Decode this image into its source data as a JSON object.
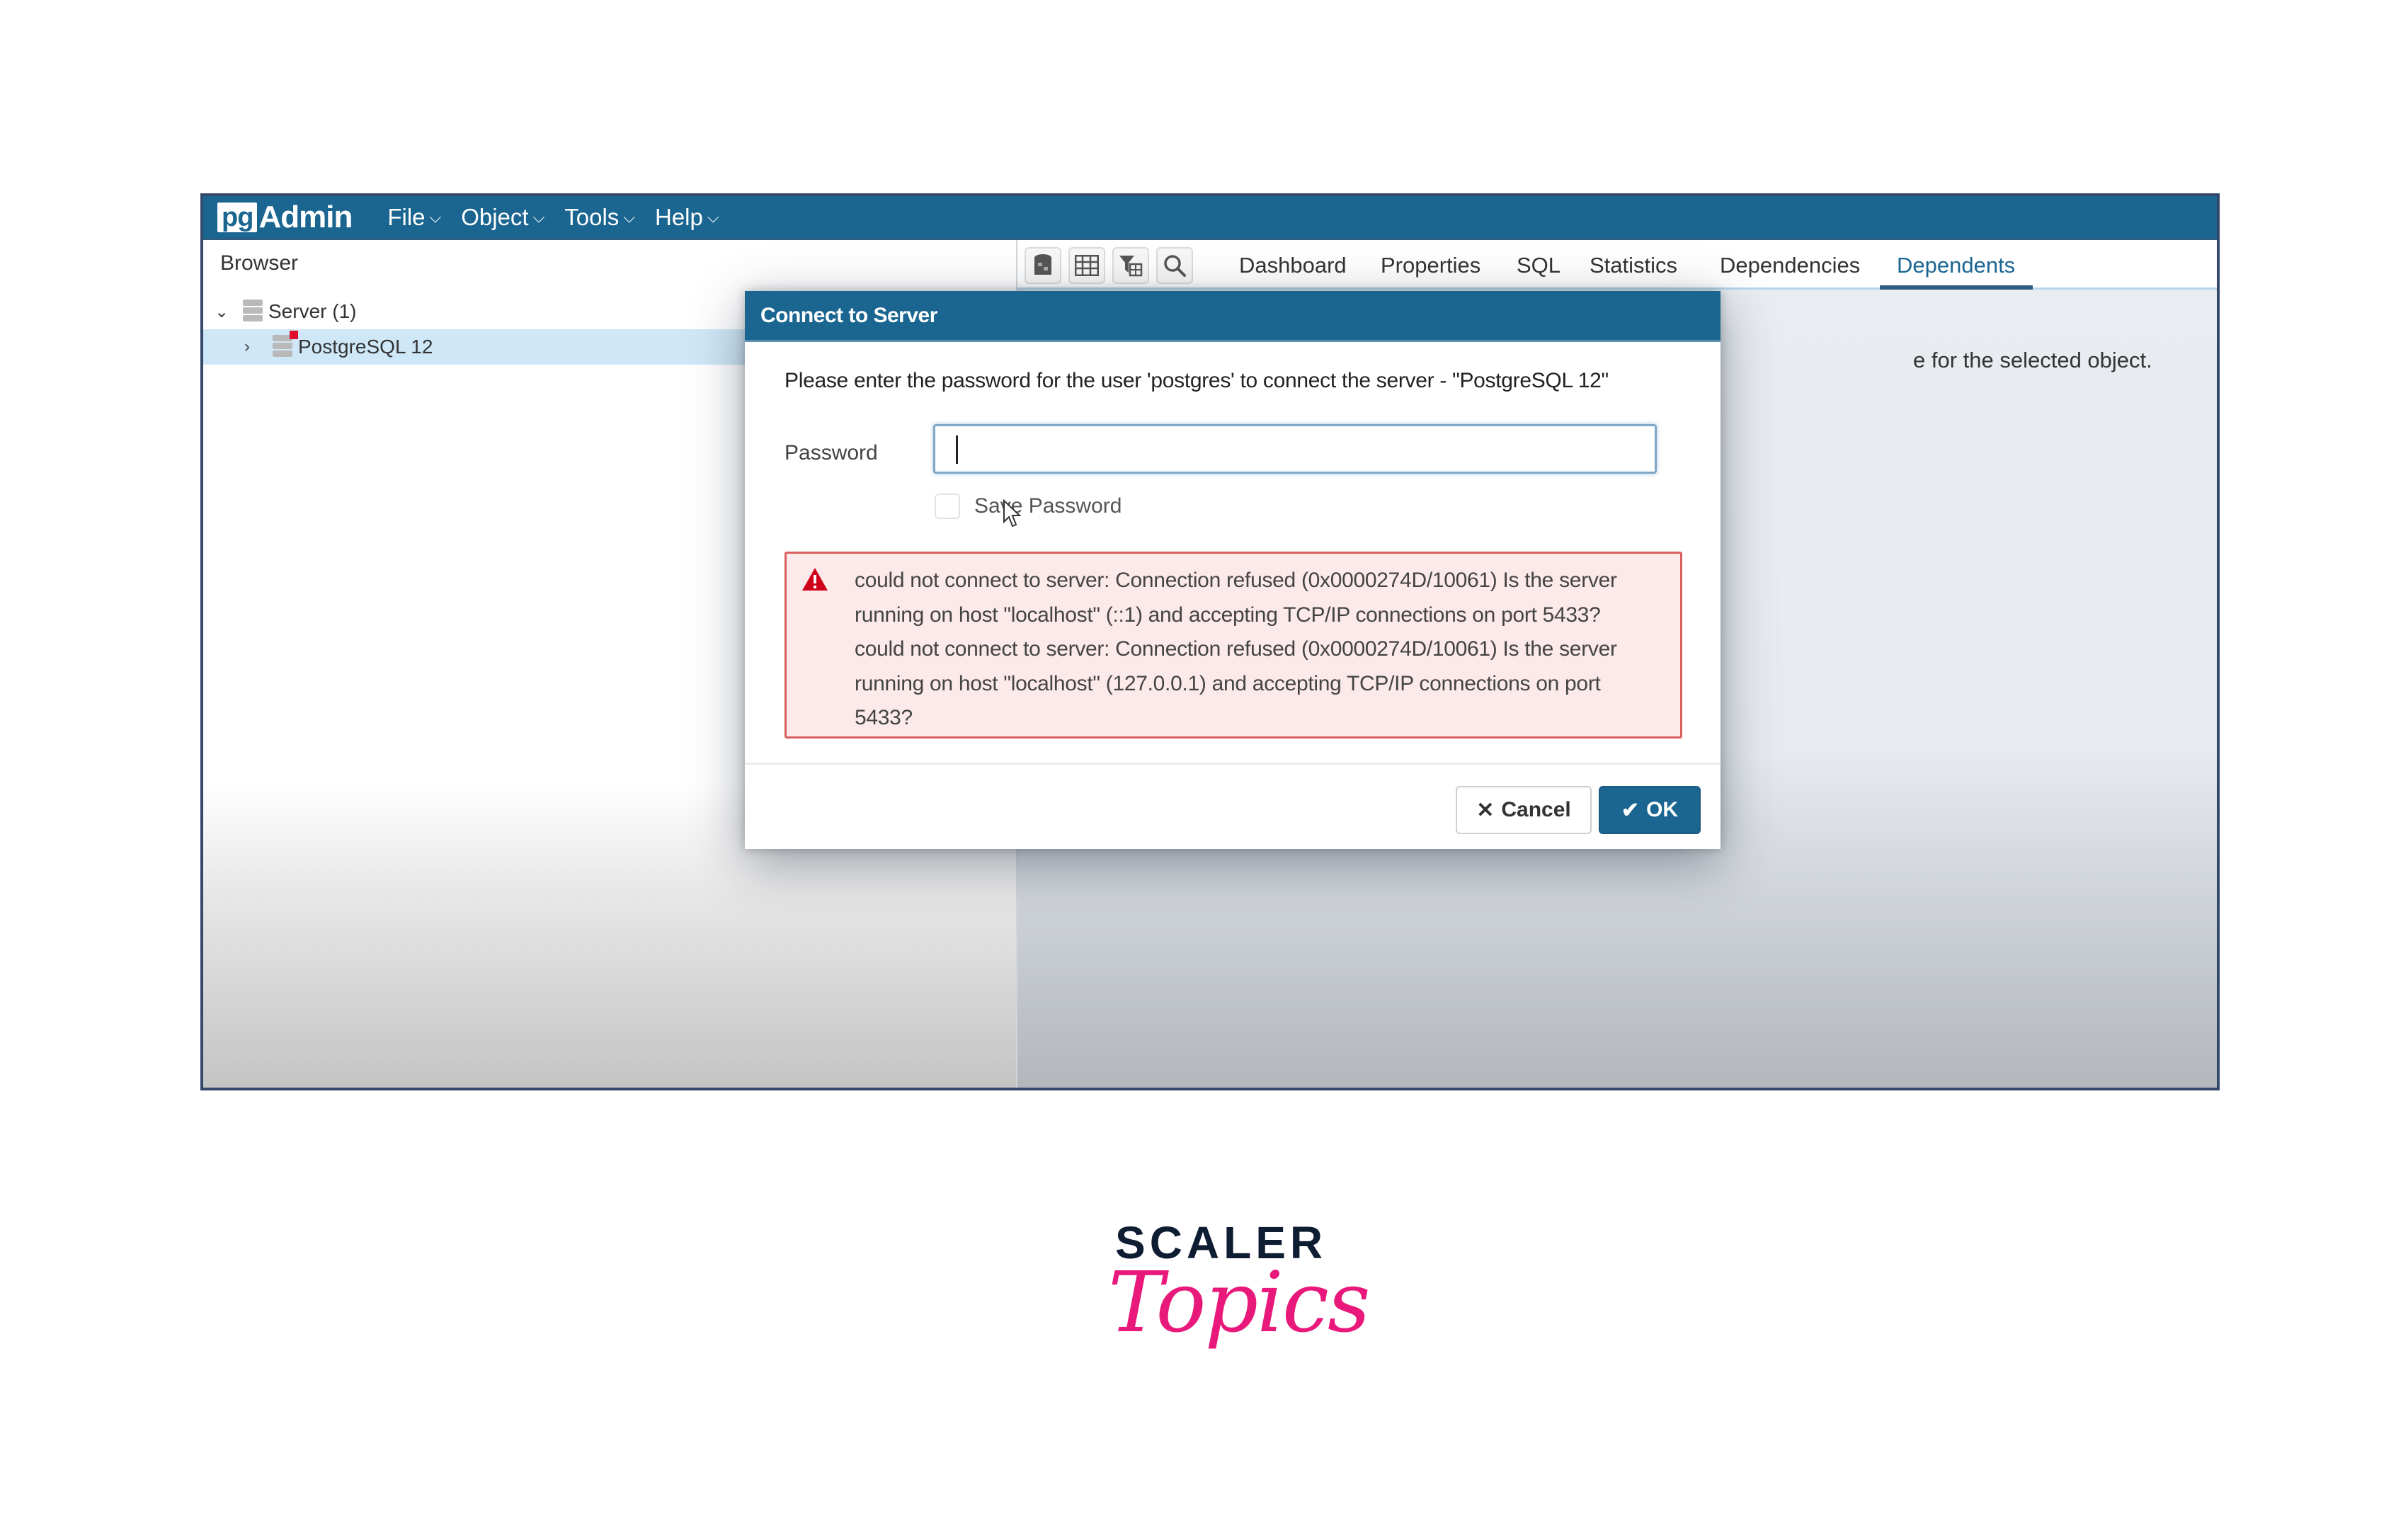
{
  "app": {
    "logo_pg": "pg",
    "logo_admin": "Admin",
    "menu": [
      {
        "label": "File",
        "icon": "chevron-down-icon"
      },
      {
        "label": "Object",
        "icon": "chevron-down-icon"
      },
      {
        "label": "Tools",
        "icon": "chevron-down-icon"
      },
      {
        "label": "Help",
        "icon": "chevron-down-icon"
      }
    ]
  },
  "browser": {
    "title": "Browser",
    "tree": [
      {
        "label": "Server (1)",
        "expanded": true,
        "icon": "server-group-icon"
      },
      {
        "label": "PostgreSQL 12",
        "expanded": false,
        "selected": true,
        "icon": "server-disconnected-icon"
      }
    ]
  },
  "toolbar": {
    "icons": [
      "query-tool-icon",
      "view-data-icon",
      "filtered-rows-icon",
      "search-objects-icon"
    ]
  },
  "tabs": [
    {
      "label": "Dashboard"
    },
    {
      "label": "Properties"
    },
    {
      "label": "SQL"
    },
    {
      "label": "Statistics"
    },
    {
      "label": "Dependencies"
    },
    {
      "label": "Dependents",
      "active": true
    }
  ],
  "content": {
    "info_text": "e for the selected object."
  },
  "dialog": {
    "title": "Connect to Server",
    "message": "Please enter the password for the user 'postgres' to connect the server - \"PostgreSQL 12\"",
    "password_label": "Password",
    "password_value": "",
    "save_password_label": "Save Password",
    "save_password_checked": false,
    "error_message": "could not connect to server: Connection refused (0x0000274D/10061) Is the server running on host \"localhost\" (::1) and accepting TCP/IP connections on port 5433? could not connect to server: Connection refused (0x0000274D/10061) Is the server running on host \"localhost\" (127.0.0.1) and accepting TCP/IP connections on port 5433?",
    "cancel_label": "Cancel",
    "ok_label": "OK"
  },
  "branding": {
    "line1": "SCALER",
    "line2": "Topics",
    "colors": {
      "scaler": "#0f1d33",
      "topics": "#e8197a"
    }
  },
  "colors": {
    "primary": "#1b6691",
    "error_bg": "#fce9e9",
    "error_border": "#d9605f",
    "selection": "#cfe8f7"
  }
}
